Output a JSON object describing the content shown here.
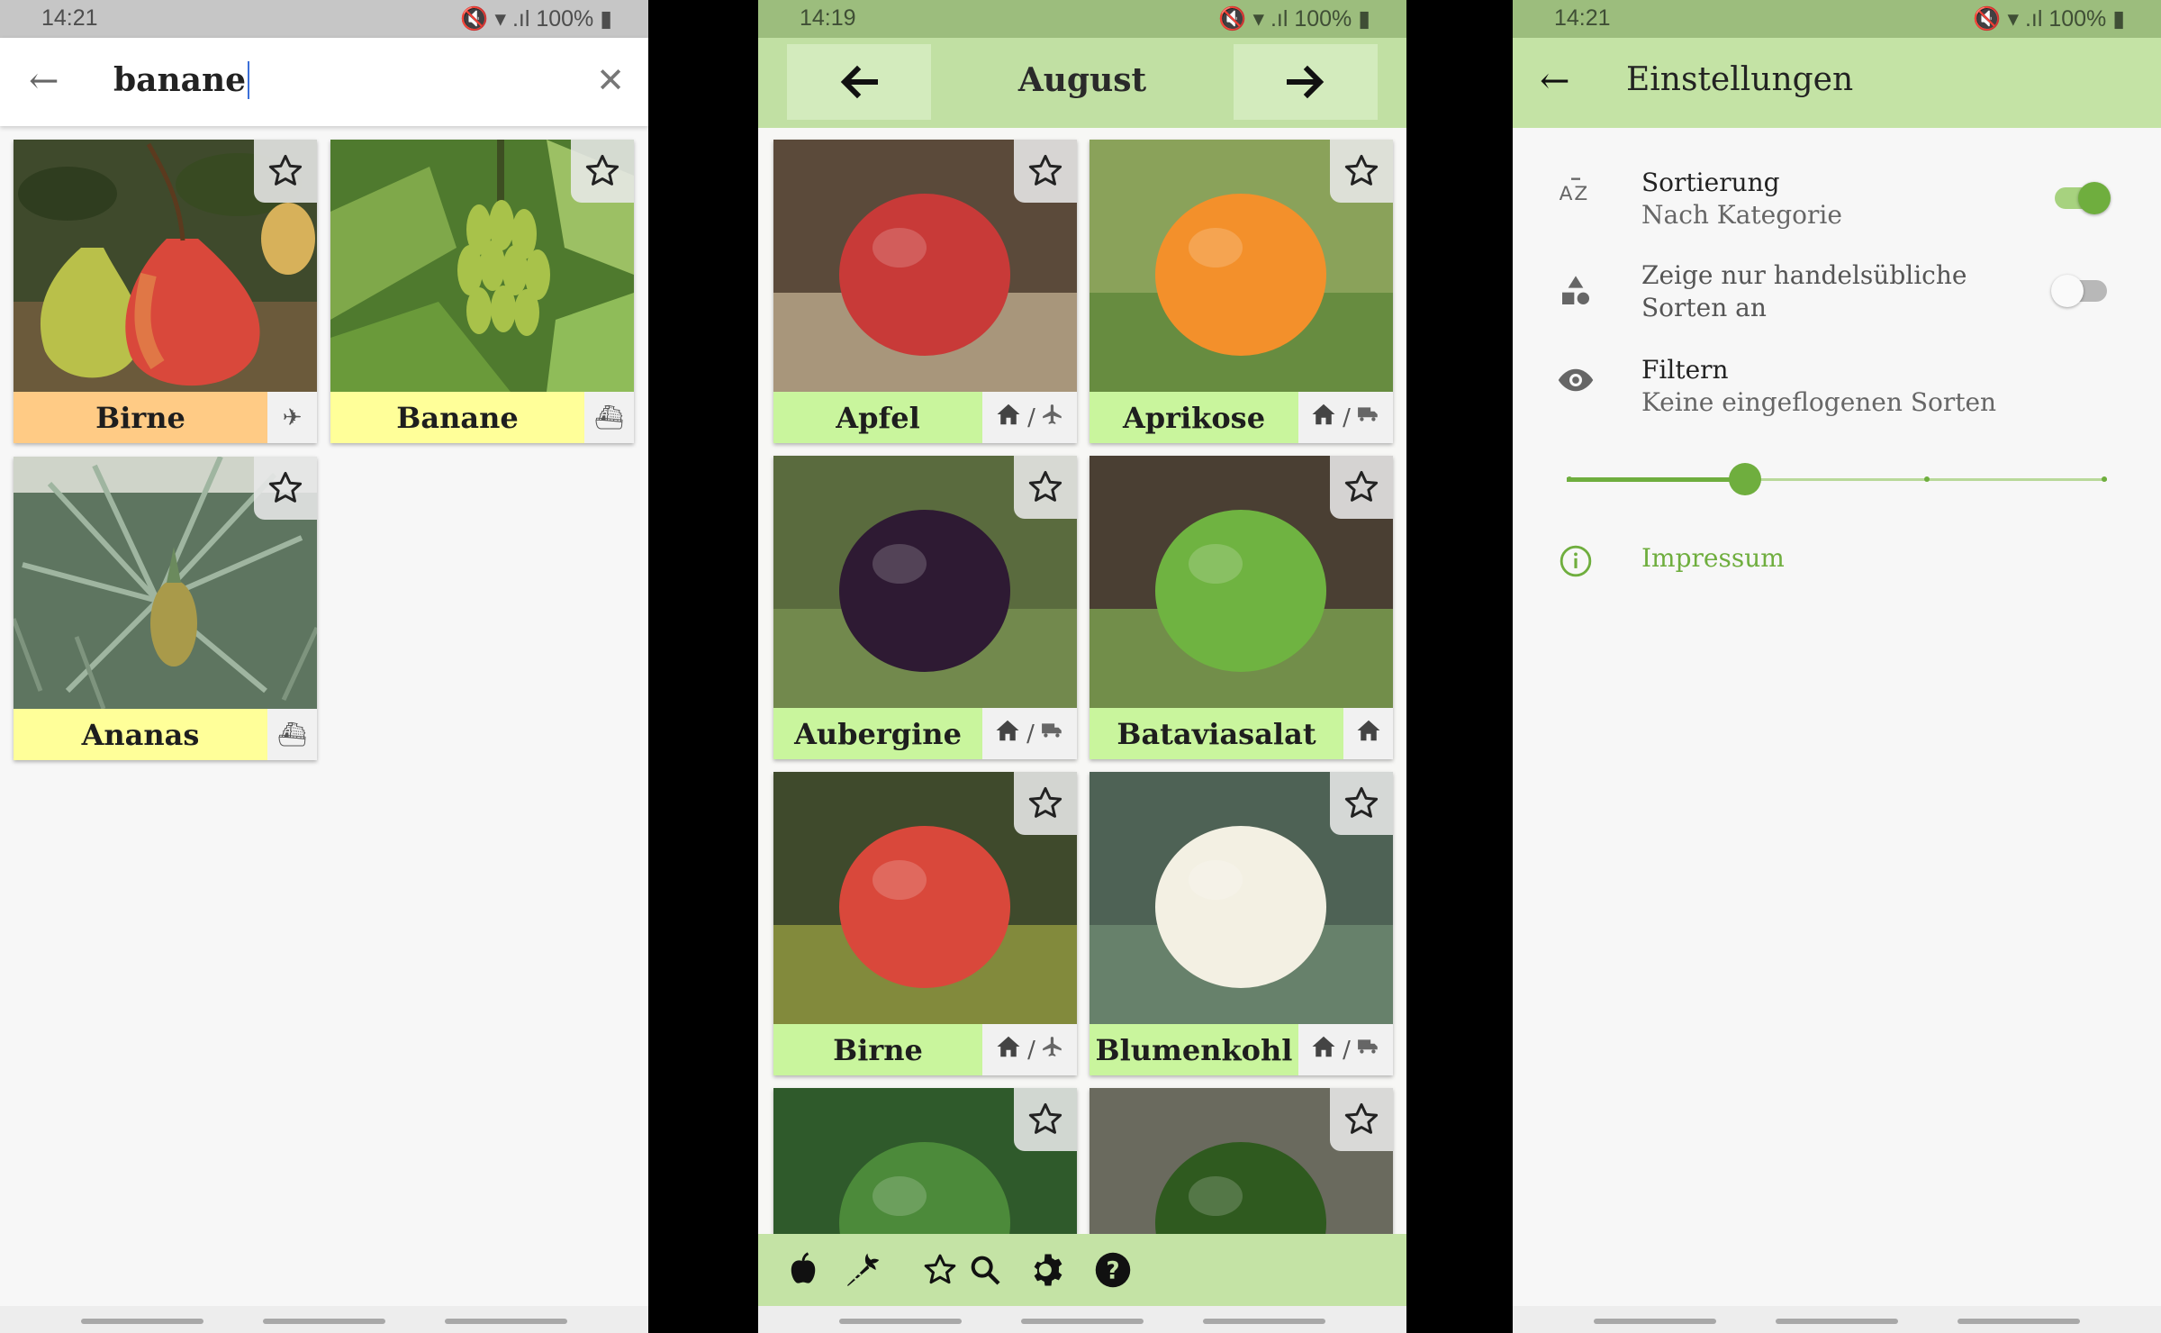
{
  "search_screen": {
    "status": {
      "time": "14:21",
      "battery": "100%"
    },
    "query": "banane",
    "results": [
      {
        "name": "Birne",
        "label_color": "#ffcb85",
        "origin_icons": [
          "plane-icon"
        ]
      },
      {
        "name": "Banane",
        "label_color": "#ffff99",
        "origin_icons": [
          "ship-icon"
        ]
      },
      {
        "name": "Ananas",
        "label_color": "#ffff99",
        "origin_icons": [
          "ship-icon"
        ]
      }
    ]
  },
  "month_screen": {
    "status": {
      "time": "14:19",
      "battery": "100%"
    },
    "month": "August",
    "items": [
      {
        "name": "Apfel",
        "label_color": "#c9f59d",
        "origin_icons": [
          "home-icon",
          "plane-icon"
        ],
        "separator": "/"
      },
      {
        "name": "Aprikose",
        "label_color": "#c9f59d",
        "origin_icons": [
          "home-icon",
          "truck-icon"
        ],
        "separator": "/"
      },
      {
        "name": "Aubergine",
        "label_color": "#c9f59d",
        "origin_icons": [
          "home-icon",
          "truck-icon"
        ],
        "separator": "/"
      },
      {
        "name": "Bataviasalat",
        "label_color": "#c9f59d",
        "origin_icons": [
          "home-icon"
        ],
        "separator": ""
      },
      {
        "name": "Birne",
        "label_color": "#c9f59d",
        "origin_icons": [
          "home-icon",
          "plane-icon"
        ],
        "separator": "/"
      },
      {
        "name": "Blumenkohl",
        "label_color": "#c9f59d",
        "origin_icons": [
          "home-icon",
          "truck-icon"
        ],
        "separator": "/"
      },
      {
        "name": "",
        "label_color": "#c9f59d",
        "origin_icons": [],
        "separator": ""
      },
      {
        "name": "",
        "label_color": "#c9f59d",
        "origin_icons": [],
        "separator": ""
      }
    ],
    "tabs": [
      "apple-icon",
      "carrot-icon",
      "star-icon",
      "search-icon",
      "gear-icon",
      "help-icon"
    ]
  },
  "settings_screen": {
    "status": {
      "time": "14:21",
      "battery": "100%"
    },
    "title": "Einstellungen",
    "sort": {
      "title": "Sortierung",
      "subtitle": "Nach Kategorie",
      "enabled": true
    },
    "commercial": {
      "title": "Zeige nur handelsübliche",
      "title_line2": "Sorten an",
      "enabled": false
    },
    "filter": {
      "title": "Filtern",
      "subtitle": "Keine eingeflogenen Sorten",
      "slider_position": 0.33
    },
    "imprint": "Impressum"
  },
  "colors": {
    "accent_green": "#6fae3e",
    "bar_green": "#c4e3a5"
  }
}
